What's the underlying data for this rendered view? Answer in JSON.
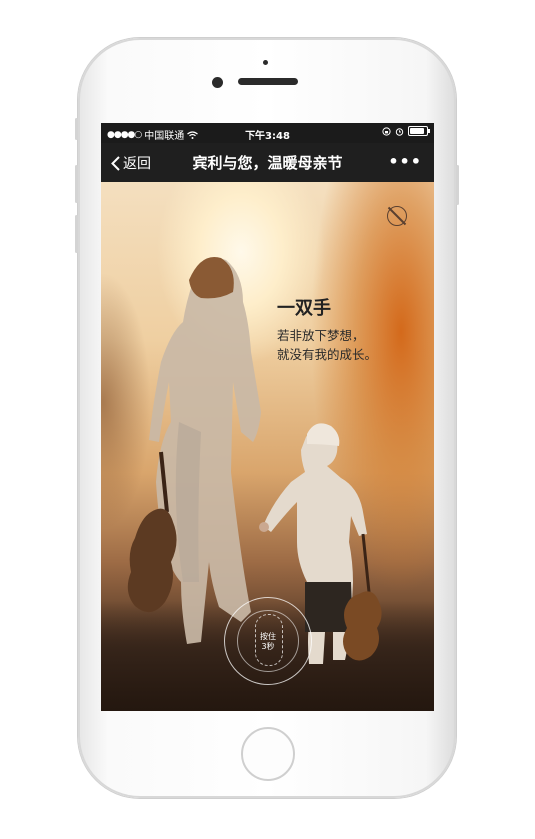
{
  "status_bar": {
    "signal": "●●●●○",
    "carrier": "中国联通",
    "time": "下午3:48",
    "battery_level": 0.85
  },
  "nav_bar": {
    "back_label": "返回",
    "title": "宾利与您，温暖母亲节",
    "more_label": "•••"
  },
  "content": {
    "headline": "一双手",
    "line1": "若非放下梦想，",
    "line2": "就没有我的成长。",
    "press_label_1": "按住",
    "press_label_2": "3秒"
  },
  "colors": {
    "nav_bg": "#1f1f1f",
    "headline_text": "#222222",
    "sky_warm": "#f4dfbf",
    "foliage_orange": "#d26414"
  },
  "icons": [
    "back-chevron-icon",
    "wifi-icon",
    "lock-rotation-icon",
    "alarm-icon",
    "battery-icon",
    "music-toggle-icon",
    "fingerprint-icon"
  ]
}
